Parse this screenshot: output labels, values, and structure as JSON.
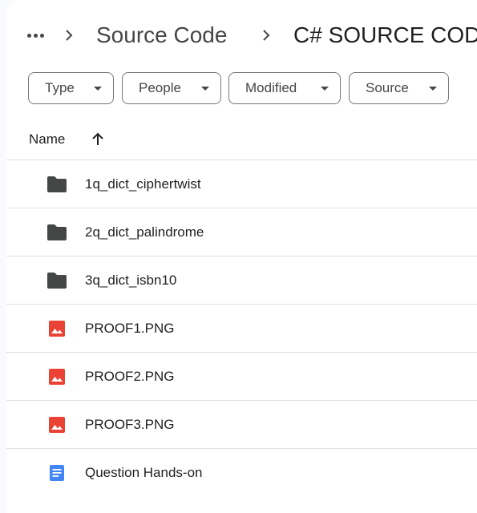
{
  "breadcrumb": {
    "items": [
      "Source Code",
      "C# SOURCE CODE"
    ]
  },
  "filters": [
    {
      "label": "Type"
    },
    {
      "label": "People"
    },
    {
      "label": "Modified"
    },
    {
      "label": "Source"
    }
  ],
  "table": {
    "column_name": "Name",
    "sort": "ascending"
  },
  "files": [
    {
      "name": "1q_dict_ciphertwist",
      "type": "folder"
    },
    {
      "name": "2q_dict_palindrome",
      "type": "folder"
    },
    {
      "name": "3q_dict_isbn10",
      "type": "folder"
    },
    {
      "name": "PROOF1.PNG",
      "type": "image"
    },
    {
      "name": "PROOF2.PNG",
      "type": "image"
    },
    {
      "name": "PROOF3.PNG",
      "type": "image"
    },
    {
      "name": "Question Hands-on",
      "type": "document"
    }
  ],
  "colors": {
    "folder": "#444746",
    "image": "#ea4335",
    "document": "#4285f4"
  }
}
